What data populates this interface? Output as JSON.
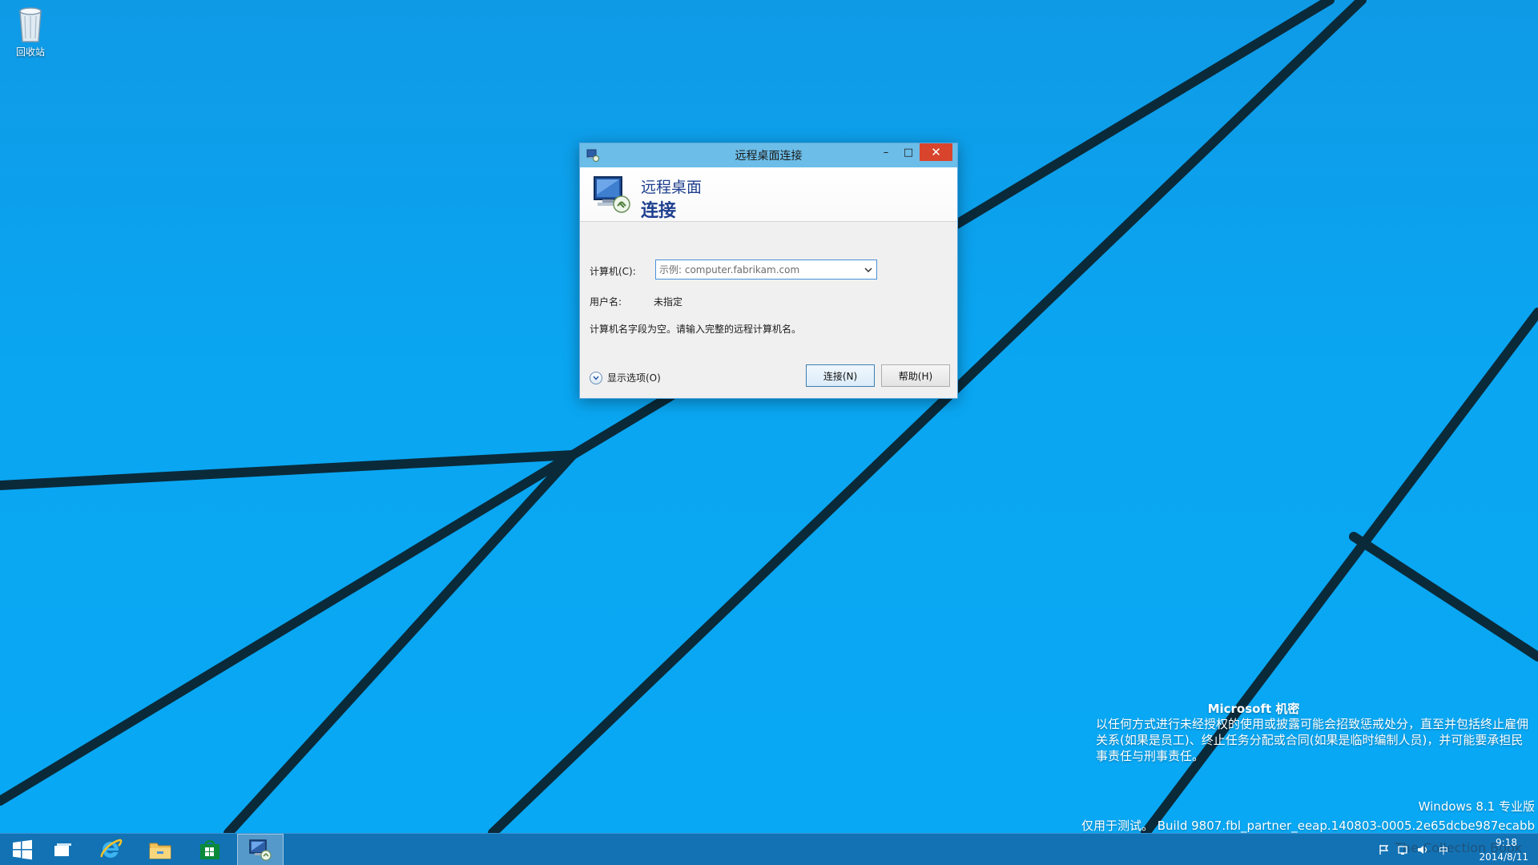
{
  "desktop": {
    "recycle_bin_label": "回收站"
  },
  "watermark": {
    "title": "Microsoft 机密",
    "body": "以任何方式进行未经授权的使用或披露可能会招致惩戒处分，直至并包括终止雇佣关系(如果是员工)、终止任务分配或合同(如果是临时编制人员)，并可能要承担民事责任与刑事责任。",
    "edition": "Windows 8.1 专业版",
    "build": "仅用于测试。 Build 9807.fbl_partner_eeap.140803-0005.2e65dcbe987ecabb"
  },
  "dialog": {
    "title": "远程桌面连接",
    "minimize_glyph": "–",
    "maximize_glyph": "□",
    "close_glyph": "✕",
    "banner_line1": "远程桌面",
    "banner_line2": "连接",
    "computer_label": "计算机(C):",
    "computer_placeholder": "示例: computer.fabrikam.com",
    "computer_value": "",
    "username_label": "用户名:",
    "username_value": "未指定",
    "message": "计算机名字段为空。请输入完整的远程计算机名。",
    "show_options_label": "显示选项(O)",
    "connect_label": "连接(N)",
    "help_label": "帮助(H)"
  },
  "taskbar": {
    "items": [
      "start-icon",
      "task-view-icon",
      "internet-explorer-icon",
      "file-explorer-icon",
      "store-icon",
      "remote-desktop-icon"
    ],
    "tray_input_indicator": "中",
    "publisher_watermark": "The Collection Book",
    "clock_time": "9:18",
    "clock_date": "2014/8/11"
  },
  "colors": {
    "desktop_blue": "#0aa6f0",
    "titlebar": "#6cbde8",
    "close_button": "#d9442d",
    "banner_text": "#1f3f8f"
  }
}
